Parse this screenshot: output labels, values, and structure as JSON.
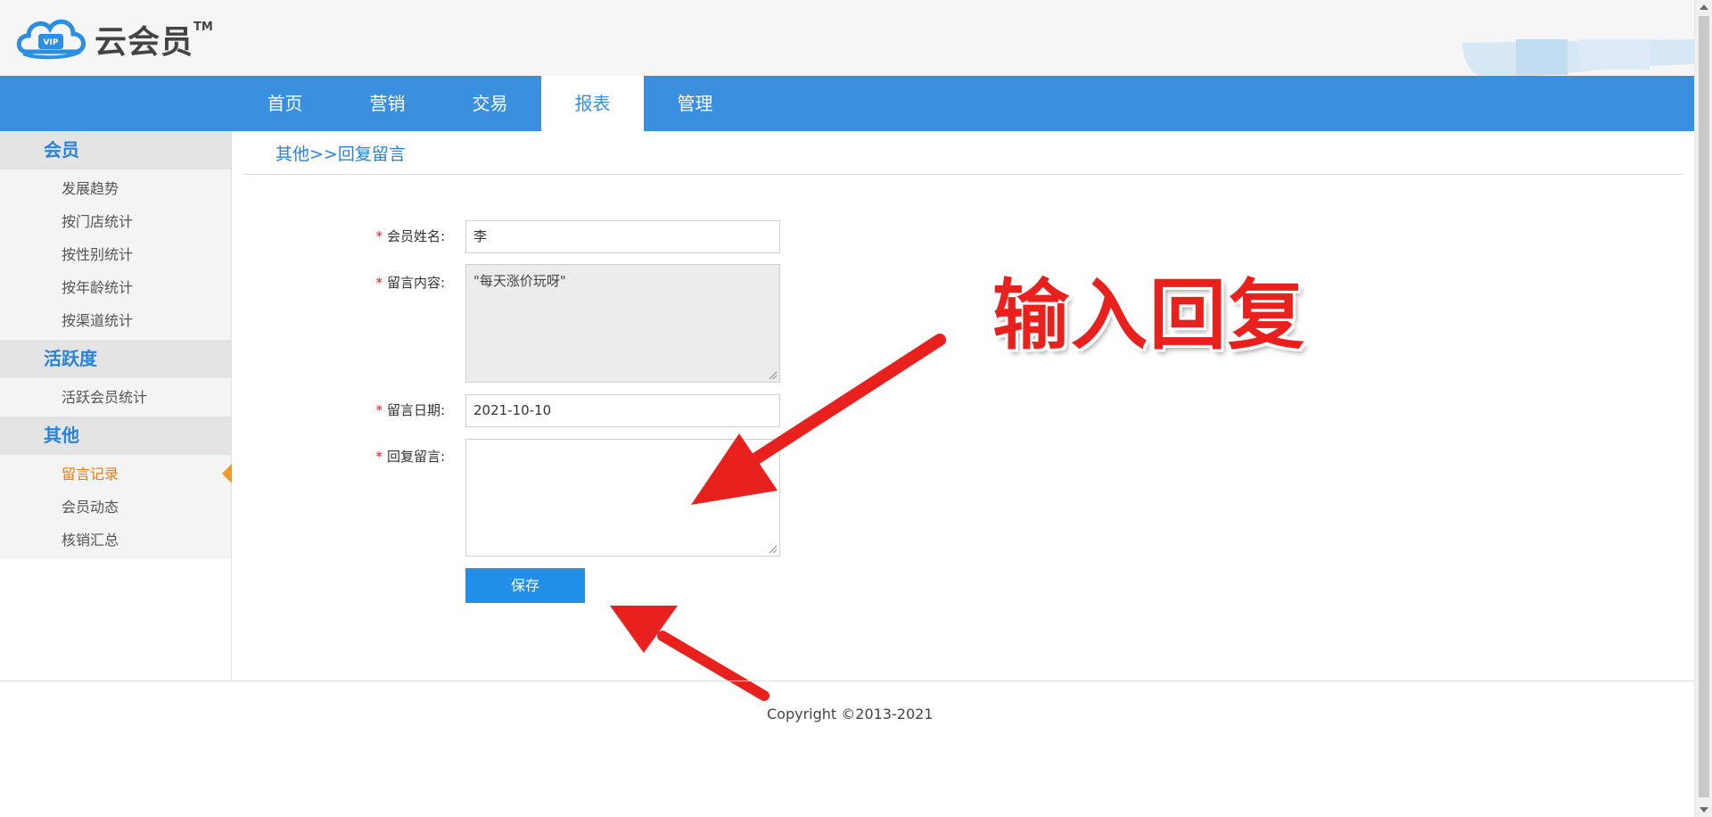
{
  "brand": {
    "name": "云会员",
    "tm": "TM",
    "logo_badge": "VIP",
    "icon": "cloud-vip-logo"
  },
  "nav": {
    "tabs": [
      {
        "label": "首页"
      },
      {
        "label": "营销"
      },
      {
        "label": "交易"
      },
      {
        "label": "报表",
        "active": true
      },
      {
        "label": "管理"
      }
    ],
    "color": "#3a8fde"
  },
  "sidebar": {
    "groups": [
      {
        "title": "会员",
        "items": [
          "发展趋势",
          "按门店统计",
          "按性别统计",
          "按年龄统计",
          "按渠道统计"
        ]
      },
      {
        "title": "活跃度",
        "items": [
          "活跃会员统计"
        ]
      },
      {
        "title": "其他",
        "items": [
          "留言记录",
          "会员动态",
          "核销汇总"
        ],
        "active_item": "留言记录"
      }
    ],
    "active_color": "#ee7a12"
  },
  "breadcrumb": "其他>>回复留言",
  "form": {
    "member_name": {
      "label": "会员姓名:",
      "value": "李"
    },
    "message_content": {
      "label": "留言内容:",
      "value": "\"每天涨价玩呀\""
    },
    "message_date": {
      "label": "留言日期:",
      "value": "2021-10-10"
    },
    "reply": {
      "label": "回复留言:",
      "value": ""
    },
    "required_mark": "*",
    "save_label": "保存"
  },
  "annotation": {
    "text": "输入回复",
    "color": "#e8201e"
  },
  "footer": {
    "copyright": "Copyright ©2013-2021"
  }
}
